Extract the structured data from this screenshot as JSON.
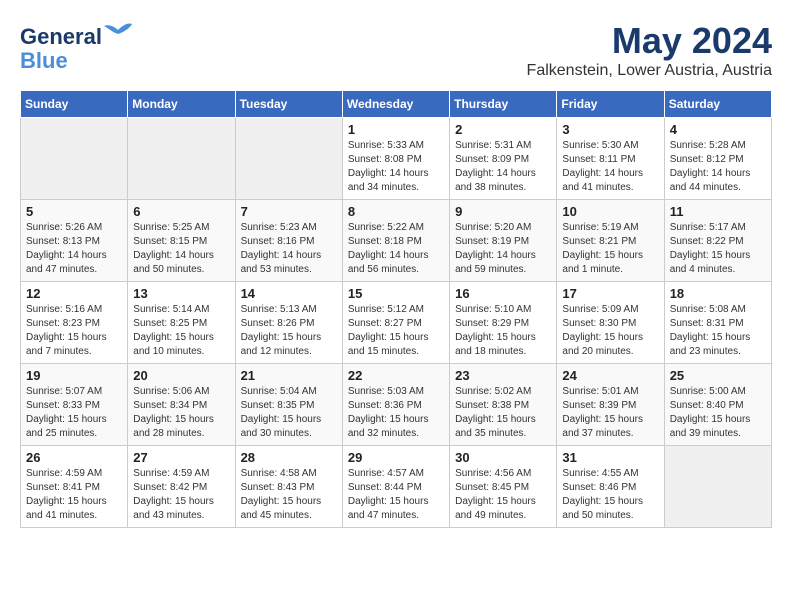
{
  "header": {
    "logo_line1": "General",
    "logo_line2": "Blue",
    "month_title": "May 2024",
    "location": "Falkenstein, Lower Austria, Austria"
  },
  "days_of_week": [
    "Sunday",
    "Monday",
    "Tuesday",
    "Wednesday",
    "Thursday",
    "Friday",
    "Saturday"
  ],
  "weeks": [
    [
      {
        "day": "",
        "empty": true
      },
      {
        "day": "",
        "empty": true
      },
      {
        "day": "",
        "empty": true
      },
      {
        "day": "1",
        "sunrise": "5:33 AM",
        "sunset": "8:08 PM",
        "daylight": "14 hours and 34 minutes."
      },
      {
        "day": "2",
        "sunrise": "5:31 AM",
        "sunset": "8:09 PM",
        "daylight": "14 hours and 38 minutes."
      },
      {
        "day": "3",
        "sunrise": "5:30 AM",
        "sunset": "8:11 PM",
        "daylight": "14 hours and 41 minutes."
      },
      {
        "day": "4",
        "sunrise": "5:28 AM",
        "sunset": "8:12 PM",
        "daylight": "14 hours and 44 minutes."
      }
    ],
    [
      {
        "day": "5",
        "sunrise": "5:26 AM",
        "sunset": "8:13 PM",
        "daylight": "14 hours and 47 minutes."
      },
      {
        "day": "6",
        "sunrise": "5:25 AM",
        "sunset": "8:15 PM",
        "daylight": "14 hours and 50 minutes."
      },
      {
        "day": "7",
        "sunrise": "5:23 AM",
        "sunset": "8:16 PM",
        "daylight": "14 hours and 53 minutes."
      },
      {
        "day": "8",
        "sunrise": "5:22 AM",
        "sunset": "8:18 PM",
        "daylight": "14 hours and 56 minutes."
      },
      {
        "day": "9",
        "sunrise": "5:20 AM",
        "sunset": "8:19 PM",
        "daylight": "14 hours and 59 minutes."
      },
      {
        "day": "10",
        "sunrise": "5:19 AM",
        "sunset": "8:21 PM",
        "daylight": "15 hours and 1 minute."
      },
      {
        "day": "11",
        "sunrise": "5:17 AM",
        "sunset": "8:22 PM",
        "daylight": "15 hours and 4 minutes."
      }
    ],
    [
      {
        "day": "12",
        "sunrise": "5:16 AM",
        "sunset": "8:23 PM",
        "daylight": "15 hours and 7 minutes."
      },
      {
        "day": "13",
        "sunrise": "5:14 AM",
        "sunset": "8:25 PM",
        "daylight": "15 hours and 10 minutes."
      },
      {
        "day": "14",
        "sunrise": "5:13 AM",
        "sunset": "8:26 PM",
        "daylight": "15 hours and 12 minutes."
      },
      {
        "day": "15",
        "sunrise": "5:12 AM",
        "sunset": "8:27 PM",
        "daylight": "15 hours and 15 minutes."
      },
      {
        "day": "16",
        "sunrise": "5:10 AM",
        "sunset": "8:29 PM",
        "daylight": "15 hours and 18 minutes."
      },
      {
        "day": "17",
        "sunrise": "5:09 AM",
        "sunset": "8:30 PM",
        "daylight": "15 hours and 20 minutes."
      },
      {
        "day": "18",
        "sunrise": "5:08 AM",
        "sunset": "8:31 PM",
        "daylight": "15 hours and 23 minutes."
      }
    ],
    [
      {
        "day": "19",
        "sunrise": "5:07 AM",
        "sunset": "8:33 PM",
        "daylight": "15 hours and 25 minutes."
      },
      {
        "day": "20",
        "sunrise": "5:06 AM",
        "sunset": "8:34 PM",
        "daylight": "15 hours and 28 minutes."
      },
      {
        "day": "21",
        "sunrise": "5:04 AM",
        "sunset": "8:35 PM",
        "daylight": "15 hours and 30 minutes."
      },
      {
        "day": "22",
        "sunrise": "5:03 AM",
        "sunset": "8:36 PM",
        "daylight": "15 hours and 32 minutes."
      },
      {
        "day": "23",
        "sunrise": "5:02 AM",
        "sunset": "8:38 PM",
        "daylight": "15 hours and 35 minutes."
      },
      {
        "day": "24",
        "sunrise": "5:01 AM",
        "sunset": "8:39 PM",
        "daylight": "15 hours and 37 minutes."
      },
      {
        "day": "25",
        "sunrise": "5:00 AM",
        "sunset": "8:40 PM",
        "daylight": "15 hours and 39 minutes."
      }
    ],
    [
      {
        "day": "26",
        "sunrise": "4:59 AM",
        "sunset": "8:41 PM",
        "daylight": "15 hours and 41 minutes."
      },
      {
        "day": "27",
        "sunrise": "4:59 AM",
        "sunset": "8:42 PM",
        "daylight": "15 hours and 43 minutes."
      },
      {
        "day": "28",
        "sunrise": "4:58 AM",
        "sunset": "8:43 PM",
        "daylight": "15 hours and 45 minutes."
      },
      {
        "day": "29",
        "sunrise": "4:57 AM",
        "sunset": "8:44 PM",
        "daylight": "15 hours and 47 minutes."
      },
      {
        "day": "30",
        "sunrise": "4:56 AM",
        "sunset": "8:45 PM",
        "daylight": "15 hours and 49 minutes."
      },
      {
        "day": "31",
        "sunrise": "4:55 AM",
        "sunset": "8:46 PM",
        "daylight": "15 hours and 50 minutes."
      },
      {
        "day": "",
        "empty": true
      }
    ]
  ],
  "labels": {
    "sunrise": "Sunrise:",
    "sunset": "Sunset:",
    "daylight": "Daylight hours"
  }
}
